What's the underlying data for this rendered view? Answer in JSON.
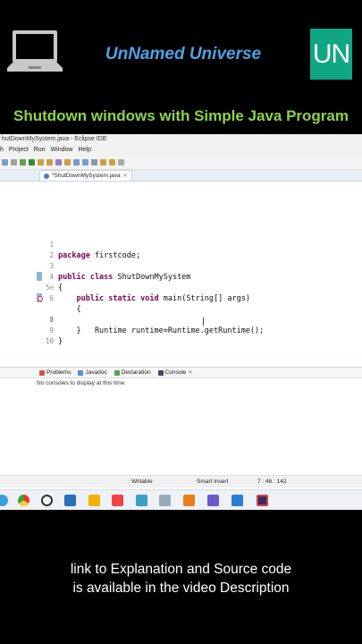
{
  "banner": {
    "brand": "UnNamed Universe",
    "logo_text": "UN",
    "headline": "Shutdown windows with Simple Java Program",
    "laptop_icon": "laptop-icon"
  },
  "ide": {
    "window_title": "hutDownMySystem.java - Eclipse IDE",
    "menu": [
      "h",
      "Project",
      "Run",
      "Window",
      "Help"
    ],
    "editor_tab": "*ShutDownMySystem.java",
    "code_lines": [
      {
        "n": "1",
        "text": "package firstcode;"
      },
      {
        "n": "2",
        "text": ""
      },
      {
        "n": "3",
        "text": "public class ShutDownMySystem"
      },
      {
        "n": "4",
        "text": "{"
      },
      {
        "n": "5⊖",
        "text": "    public static void main(String[] args)"
      },
      {
        "n": "6",
        "text": "    {"
      },
      {
        "n": "7",
        "text": "        Runtime runtime=Runtime.getRuntime();"
      },
      {
        "n": "8",
        "text": "    }"
      },
      {
        "n": "9",
        "text": "}"
      },
      {
        "n": "10",
        "text": ""
      }
    ],
    "panel_tabs": [
      "Problems",
      "Javadoc",
      "Declaration",
      "Console"
    ],
    "console_message": "No consoles to display at this time.",
    "status": {
      "writable": "Writable",
      "insert_mode": "Smart Insert",
      "position": "7 : 46 : 142"
    }
  },
  "footer": {
    "line1": "link to Explanation and Source code",
    "line2": "is available in the video Description"
  }
}
